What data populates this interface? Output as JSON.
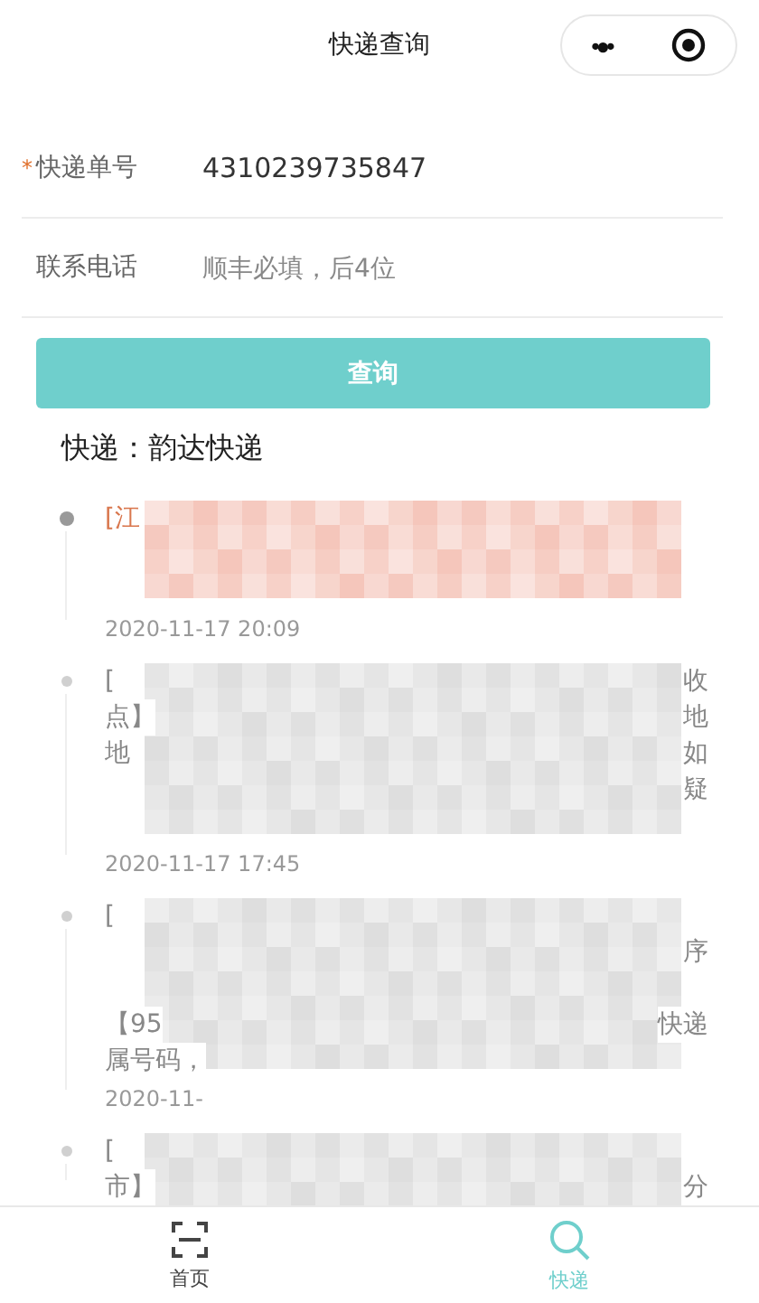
{
  "navbar": {
    "title": "快递查询",
    "capsule": {
      "more": "•●•"
    }
  },
  "form": {
    "required_mark": "*",
    "fields": [
      {
        "label": "快递单号",
        "required": true,
        "value": "4310239735847"
      },
      {
        "label": "联系电话",
        "required": false,
        "placeholder": "顺丰必填，后4位"
      }
    ],
    "submit": "查询"
  },
  "carrier": "快递：韵达快递",
  "timeline": [
    {
      "current": true,
      "lines": [
        {
          "redacted": false,
          "left": "[江"
        },
        {
          "redacted": true
        },
        {
          "redacted": true
        }
      ],
      "time": "2020-11-17 20:09"
    },
    {
      "current": false,
      "lines": [
        {
          "redacted": false,
          "left": "[",
          "right": "收"
        },
        {
          "redacted": false,
          "left": "点】",
          "right": "地"
        },
        {
          "redacted": false,
          "left": "地",
          "right": "如"
        },
        {
          "redacted": false,
          "right": "疑"
        },
        {
          "redacted": true
        }
      ],
      "time": "2020-11-17 17:45"
    },
    {
      "current": false,
      "lines": [
        {
          "redacted": false,
          "left": "["
        },
        {
          "redacted": false,
          "right": "序"
        },
        {
          "redacted": true
        },
        {
          "redacted": false,
          "left": "【95",
          "right": "快递"
        },
        {
          "redacted": false,
          "left": "属号码，"
        }
      ],
      "time": "2020-11-"
    },
    {
      "current": false,
      "lines": [
        {
          "redacted": false,
          "left": "["
        },
        {
          "redacted": false,
          "left": "市】",
          "right": "分"
        }
      ]
    }
  ],
  "tabbar": [
    {
      "label": "首页",
      "selected": false
    },
    {
      "label": "快递",
      "selected": true
    }
  ]
}
